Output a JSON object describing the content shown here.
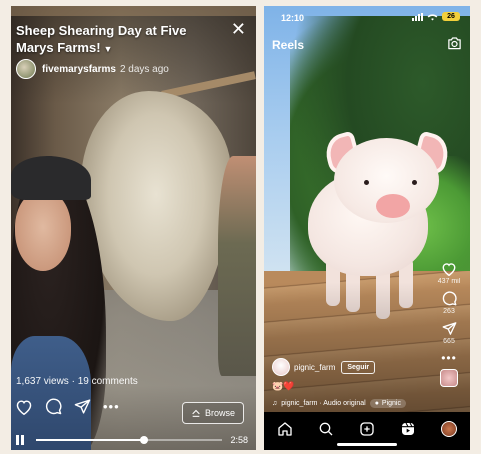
{
  "left": {
    "title": "Sheep Shearing Day at Five Marys Farms!",
    "author": {
      "handle": "fivemarysfarms",
      "time_ago": "2 days ago"
    },
    "stats": {
      "views": "1,637 views",
      "comments": "19 comments"
    },
    "browse_label": "Browse",
    "player": {
      "duration": "2:58",
      "progress": 0.58
    },
    "icons": [
      "heart-icon",
      "comment-icon",
      "share-icon",
      "more-icon",
      "close-icon",
      "pause-icon"
    ]
  },
  "right": {
    "status": {
      "time": "12:10",
      "battery": "26"
    },
    "header": {
      "title": "Reels"
    },
    "author": {
      "handle": "pignic_farm",
      "follow_label": "Seguir"
    },
    "caption": "🐷❤️",
    "audio": {
      "text": "pignic_farm · Audio original",
      "tag": "Pignic"
    },
    "actions": {
      "likes": "437 mil",
      "comments": "263",
      "shares": "665"
    },
    "tabs": [
      "home",
      "search",
      "create",
      "reels",
      "profile"
    ],
    "colors": {
      "battery": "#f2cf3b",
      "snout": "#f2a5a5"
    }
  }
}
